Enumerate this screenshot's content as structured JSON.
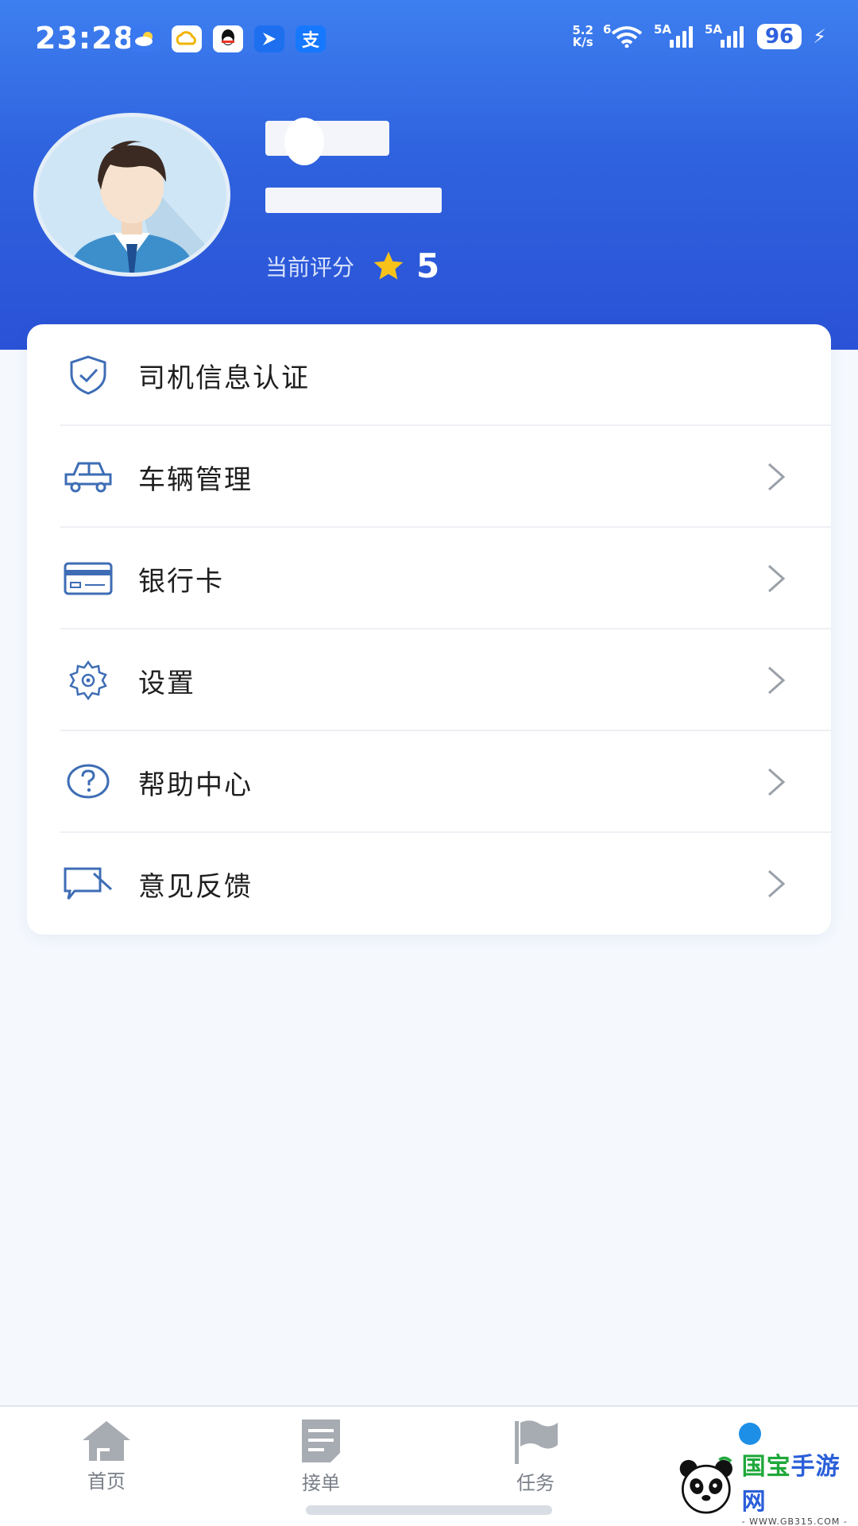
{
  "status_bar": {
    "time": "23:28",
    "net_speed_top": "5.2",
    "net_speed_bottom": "K/s",
    "wifi_label": "6",
    "signal1_label": "5A",
    "signal2_label": "5A",
    "battery": "96"
  },
  "profile": {
    "rating_label": "当前评分",
    "rating_value": "5"
  },
  "menu": {
    "items": [
      {
        "label": "司机信息认证",
        "icon": "shield-check-icon",
        "chevron": false
      },
      {
        "label": "车辆管理",
        "icon": "car-icon",
        "chevron": true
      },
      {
        "label": "银行卡",
        "icon": "bank-card-icon",
        "chevron": true
      },
      {
        "label": "设置",
        "icon": "gear-icon",
        "chevron": true
      },
      {
        "label": "帮助中心",
        "icon": "help-icon",
        "chevron": true
      },
      {
        "label": "意见反馈",
        "icon": "feedback-icon",
        "chevron": true
      }
    ]
  },
  "bottom_nav": {
    "items": [
      {
        "label": "首页",
        "icon": "home-icon"
      },
      {
        "label": "接单",
        "icon": "order-icon"
      },
      {
        "label": "任务",
        "icon": "flag-icon"
      },
      {
        "label": "",
        "icon": "user-icon",
        "active": true
      }
    ]
  },
  "watermark": {
    "title_green": "国宝",
    "title_blue": "手游网",
    "sub": "- WWW.GB315.COM -"
  },
  "colors": {
    "primary": "#2f62de",
    "header_top": "#3d7ff0",
    "star": "#f7c21a",
    "icon_blue": "#3e6db5"
  }
}
